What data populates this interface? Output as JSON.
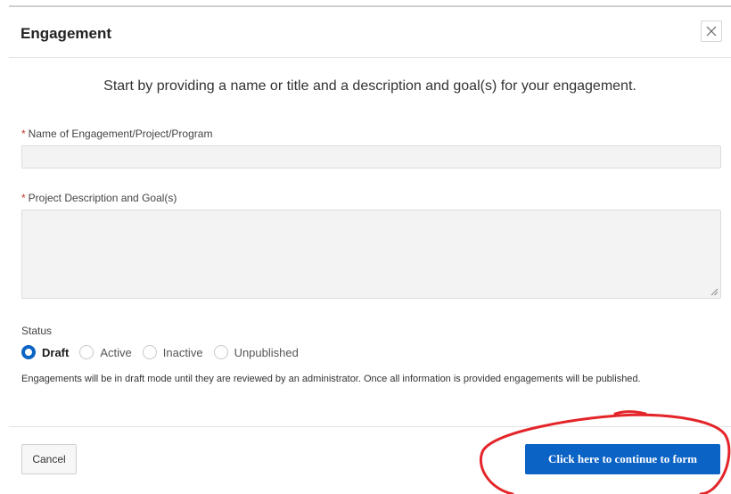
{
  "dialog": {
    "title": "Engagement",
    "close_icon": "close-icon",
    "intro": "Start by providing a name or title and a description and goal(s) for your engagement."
  },
  "form": {
    "required_marker": "*",
    "name_label": "Name of Engagement/Project/Program",
    "name_value": "",
    "description_label": "Project Description and Goal(s)",
    "description_value": "",
    "status_label": "Status",
    "status_options": [
      "Draft",
      "Active",
      "Inactive",
      "Unpublished"
    ],
    "status_selected": "Draft",
    "status_help": "Engagements will be in draft mode until they are reviewed by an administrator. Once all information is provided engagements will be published."
  },
  "footer": {
    "cancel_label": "Cancel",
    "continue_label": "Click here to continue to form"
  },
  "colors": {
    "primary": "#0b63c5",
    "required": "#c0392b",
    "annotation": "#e3252a"
  }
}
